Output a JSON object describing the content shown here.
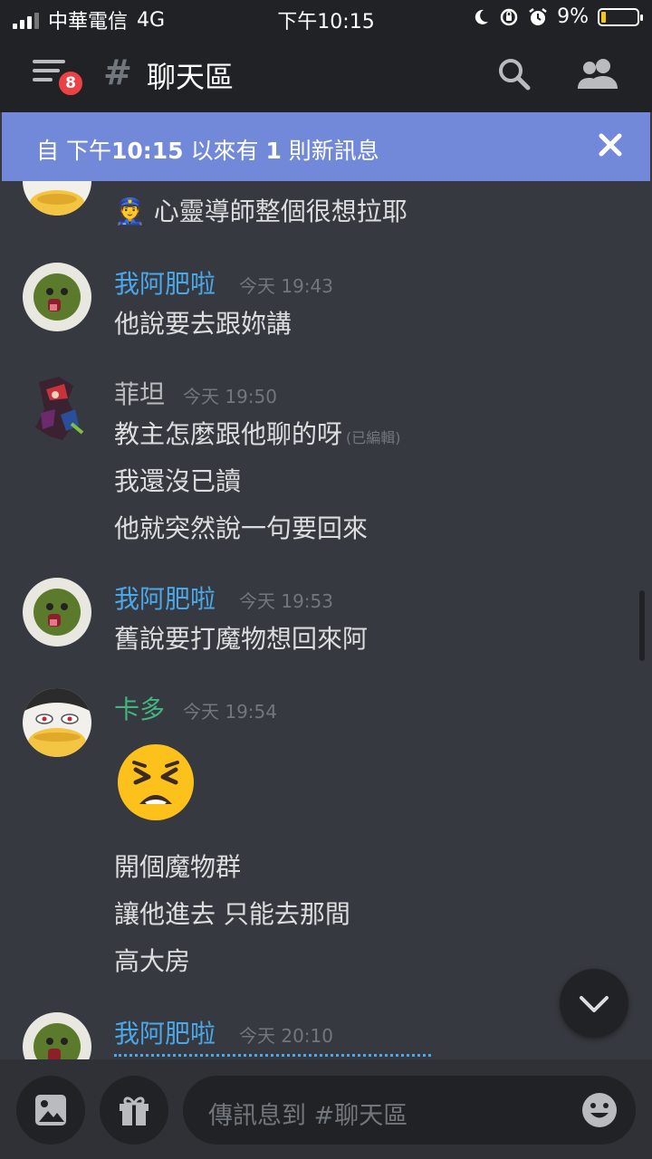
{
  "status_bar": {
    "carrier": "中華電信",
    "network": "4G",
    "time": "下午10:15",
    "battery": "9%",
    "battery_level": 0.09
  },
  "header": {
    "menu_badge": "8",
    "hash": "#",
    "channel_name": "聊天區",
    "icons": [
      "menu-icon",
      "search-icon",
      "members-icon"
    ]
  },
  "banner": {
    "text_prefix": "自 下午",
    "time": "10:15",
    "text_mid": " 以來有 ",
    "count": "1",
    "text_suffix": " 則新訊息",
    "close_icon": "close-icon",
    "color": "#7289da"
  },
  "messages": [
    {
      "author": "",
      "lines": [
        "心靈導師整個很想拉耶"
      ],
      "emoji_prefix": "👮"
    },
    {
      "author": "我阿肥啦",
      "author_color": "#4aa8ea",
      "time": "今天 19:43",
      "lines": [
        "他說要去跟妳講"
      ]
    },
    {
      "author": "菲坦",
      "author_color": "#b9bbbe",
      "time": "今天 19:50",
      "lines": [
        "教主怎麼跟他聊的呀",
        "我還沒已讀",
        "他就突然說一句要回來"
      ],
      "edited": "(已編輯)"
    },
    {
      "author": "我阿肥啦",
      "author_color": "#4aa8ea",
      "time": "今天 19:53",
      "lines": [
        "舊說要打魔物想回來阿"
      ]
    },
    {
      "author": "卡多",
      "author_color": "#43b581",
      "time": "今天 19:54",
      "emoji": "😫",
      "lines": [
        "開個魔物群",
        "讓他進去 只能去那間",
        "高大房"
      ]
    },
    {
      "author": "我阿肥啦",
      "author_color": "#4aa8ea",
      "time": "今天 20:10",
      "lines": []
    }
  ],
  "composer": {
    "placeholder": "傳訊息到 #聊天區",
    "icons": [
      "image-icon",
      "gift-icon",
      "emoji-icon",
      "chevron-down-icon"
    ]
  }
}
